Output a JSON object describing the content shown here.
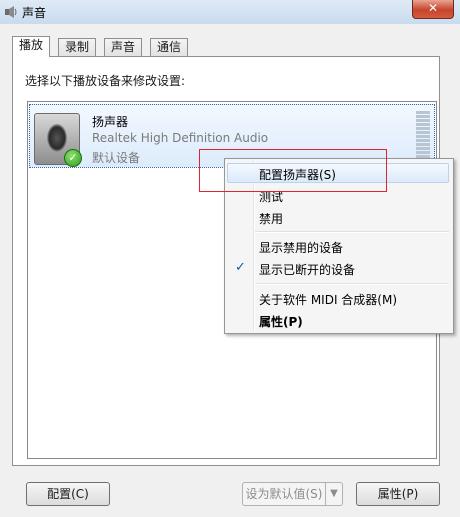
{
  "window": {
    "title": "声音",
    "close_label": "✕"
  },
  "tabs": [
    {
      "label": "播放",
      "active": true
    },
    {
      "label": "录制",
      "active": false
    },
    {
      "label": "声音",
      "active": false
    },
    {
      "label": "通信",
      "active": false
    }
  ],
  "instruction": "选择以下播放设备来修改设置:",
  "device": {
    "name": "扬声器",
    "description": "Realtek High Definition Audio",
    "status": "默认设备",
    "icon": "speaker-icon",
    "badge_icon": "check-badge-icon"
  },
  "context_menu": {
    "items": [
      {
        "label": "配置扬声器(S)",
        "bold": false,
        "checked": false
      },
      {
        "label": "测试",
        "bold": false,
        "checked": false
      },
      {
        "label": "禁用",
        "bold": false,
        "checked": false
      },
      {
        "label": "显示禁用的设备",
        "bold": false,
        "checked": false
      },
      {
        "label": "显示已断开的设备",
        "bold": false,
        "checked": true
      },
      {
        "label": "关于软件 MIDI 合成器(M)",
        "bold": false,
        "checked": false
      },
      {
        "label": "属性(P)",
        "bold": true,
        "checked": false
      }
    ],
    "check_glyph": "✓"
  },
  "buttons": {
    "configure": "配置(C)",
    "set_default": "设为默认值(S)",
    "set_default_arrow": "▼",
    "properties": "属性(P)"
  },
  "colors": {
    "highlight_box": "#e0232c",
    "selection": "#dcebfc"
  }
}
